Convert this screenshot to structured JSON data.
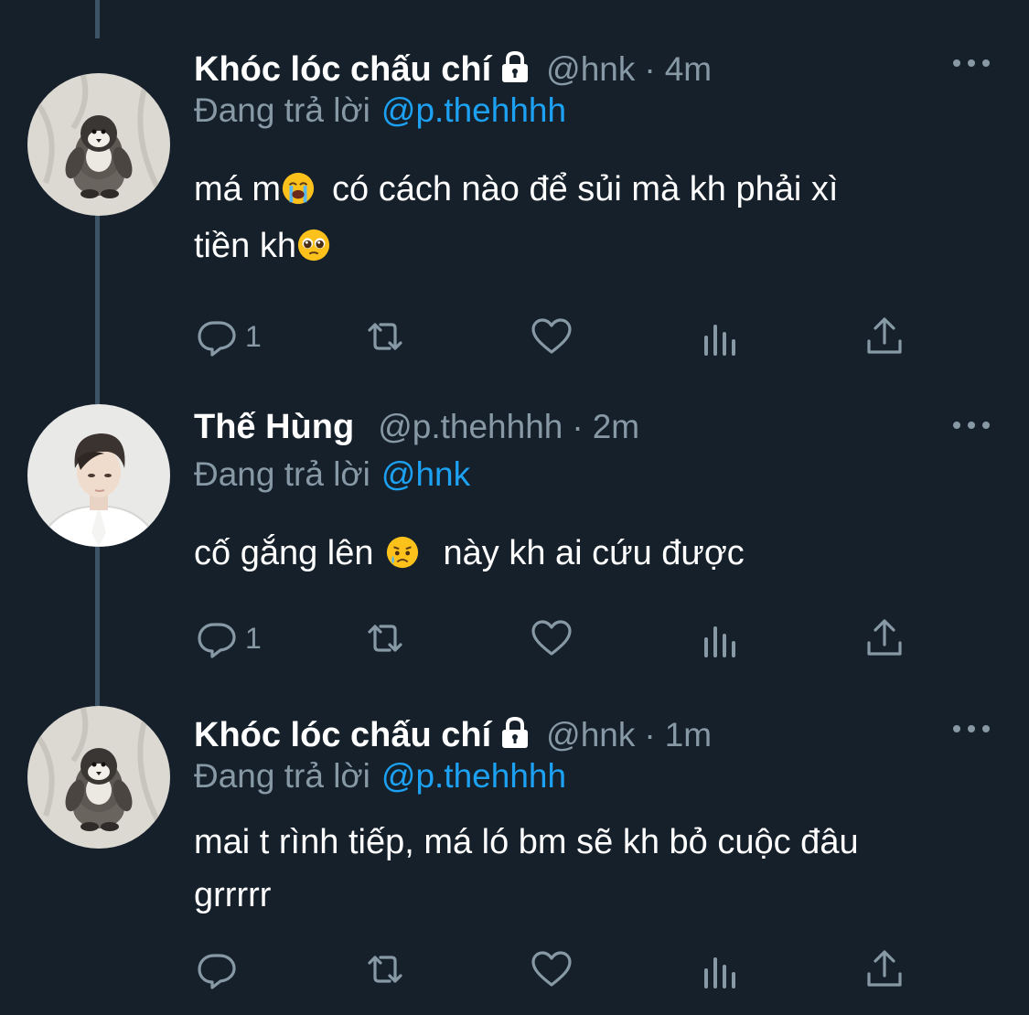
{
  "colors": {
    "background": "#15202b",
    "secondary_text": "#8899a6",
    "link": "#1da1f2",
    "thread_line": "#3d5466"
  },
  "tweets": [
    {
      "name": "Khóc lóc chấu chí",
      "protected": true,
      "handle": "@hnk",
      "separator": "·",
      "time": "4m",
      "replying_label": "Đang trả lời",
      "replying_to": "@p.thehhhh",
      "text_line1_a": "má m",
      "text_line1_b": "có cách nào để sủi mà kh phải xì",
      "text_line2": "tiền kh",
      "reply_count": "1",
      "emoji1": "loudly-crying-emoji",
      "emoji2": "pleading-face-emoji"
    },
    {
      "name": "Thế Hùng",
      "handle": "@p.thehhhh",
      "separator": "·",
      "time": "2m",
      "replying_label": "Đang trả lời",
      "replying_to": "@hnk",
      "text_a": "cố gắng lên",
      "text_b": "này kh ai cứu được",
      "reply_count": "1",
      "emoji1": "sad-relieved-face-emoji"
    },
    {
      "name": "Khóc lóc chấu chí",
      "protected": true,
      "handle": "@hnk",
      "separator": "·",
      "time": "1m",
      "replying_label": "Đang trả lời",
      "replying_to": "@p.thehhhh",
      "text_line1": "mai t rình tiếp, má ló bm sẽ kh bỏ cuộc đâu",
      "text_line2": "grrrrr",
      "reply_count": ""
    }
  ]
}
